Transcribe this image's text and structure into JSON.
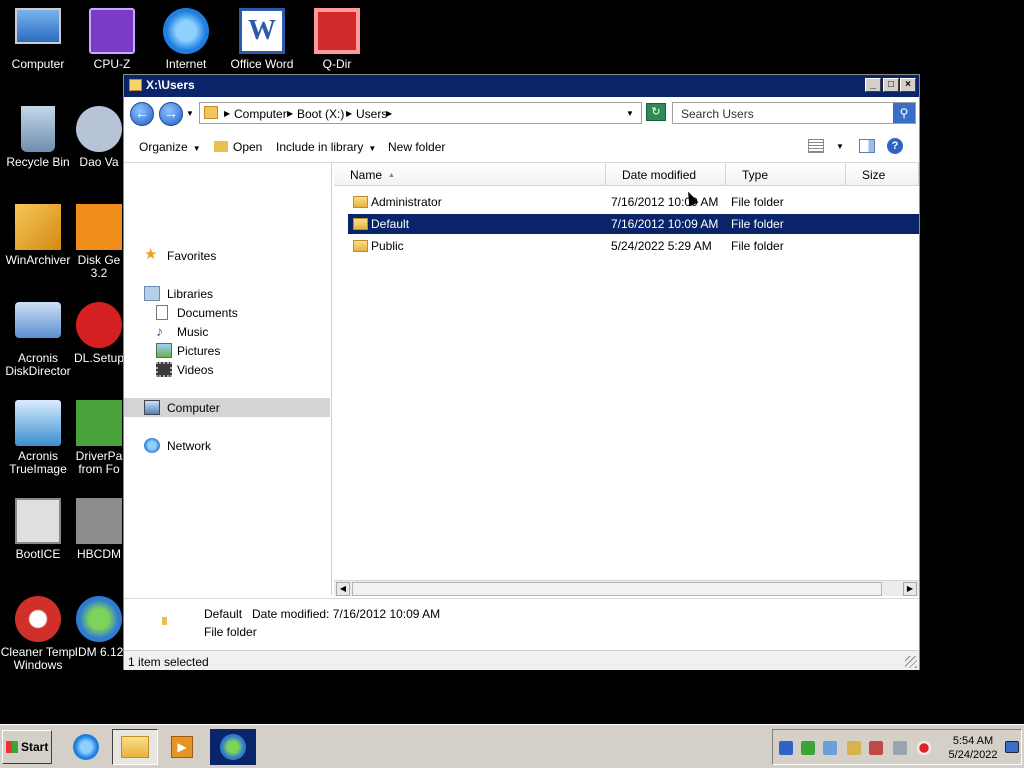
{
  "desktop": {
    "icons": [
      {
        "label": "Computer",
        "color": "#4f8fd8"
      },
      {
        "label": "CPU-Z",
        "color": "#7a3cc4"
      },
      {
        "label": "Internet",
        "color": "#1e7fe0"
      },
      {
        "label": "Office Word",
        "color": "#2b5ca8"
      },
      {
        "label": "Q-Dir",
        "color": "#d22a2a"
      },
      {
        "label": "Recycle Bin",
        "color": "#8ab0cf"
      },
      {
        "label": "Dao Va",
        "color": "#b7c4d8"
      },
      {
        "label": "WinArchiver",
        "color": "#e9a423"
      },
      {
        "label": "Disk Ge 3.2",
        "color": "#f08c1a"
      },
      {
        "label": "Acronis DiskDirector",
        "color": "#5c8fd2"
      },
      {
        "label": "DL.Setup",
        "color": "#d42020"
      },
      {
        "label": "Acronis TrueImage",
        "color": "#3a8fd0"
      },
      {
        "label": "DriverPa from Fo",
        "color": "#4aa33a"
      },
      {
        "label": "BootICE",
        "color": "#bdbdbd"
      },
      {
        "label": "HBCDM",
        "color": "#8c8c8c"
      },
      {
        "label": "Cleaner Temp Windows",
        "color": "#d0302a"
      },
      {
        "label": "IDM 6.12",
        "color": "#2e7bd1"
      }
    ]
  },
  "window": {
    "title": "X:\\Users",
    "buttons": {
      "minimize": "_",
      "maximize": "□",
      "close": "×"
    },
    "address": {
      "crumbs": [
        "Computer",
        "Boot (X:)",
        "Users"
      ]
    },
    "search": {
      "placeholder": "Search Users"
    },
    "commands": {
      "organize": "Organize",
      "open": "Open",
      "include": "Include in library",
      "new_folder": "New folder"
    },
    "nav": {
      "favorites": "Favorites",
      "libraries": "Libraries",
      "documents": "Documents",
      "music": "Music",
      "pictures": "Pictures",
      "videos": "Videos",
      "computer": "Computer",
      "network": "Network"
    },
    "columns": {
      "name": "Name",
      "date": "Date modified",
      "type": "Type",
      "size": "Size"
    },
    "rows": [
      {
        "name": "Administrator",
        "date": "7/16/2012 10:09 AM",
        "type": "File folder"
      },
      {
        "name": "Default",
        "date": "7/16/2012 10:09 AM",
        "type": "File folder"
      },
      {
        "name": "Public",
        "date": "5/24/2022 5:29 AM",
        "type": "File folder"
      }
    ],
    "details": {
      "name": "Default",
      "date_label": "Date modified:",
      "date": "7/16/2012 10:09 AM",
      "type": "File folder"
    },
    "status": "1 item selected"
  },
  "taskbar": {
    "start": "Start",
    "time": "5:54 AM",
    "date": "5/24/2022"
  }
}
